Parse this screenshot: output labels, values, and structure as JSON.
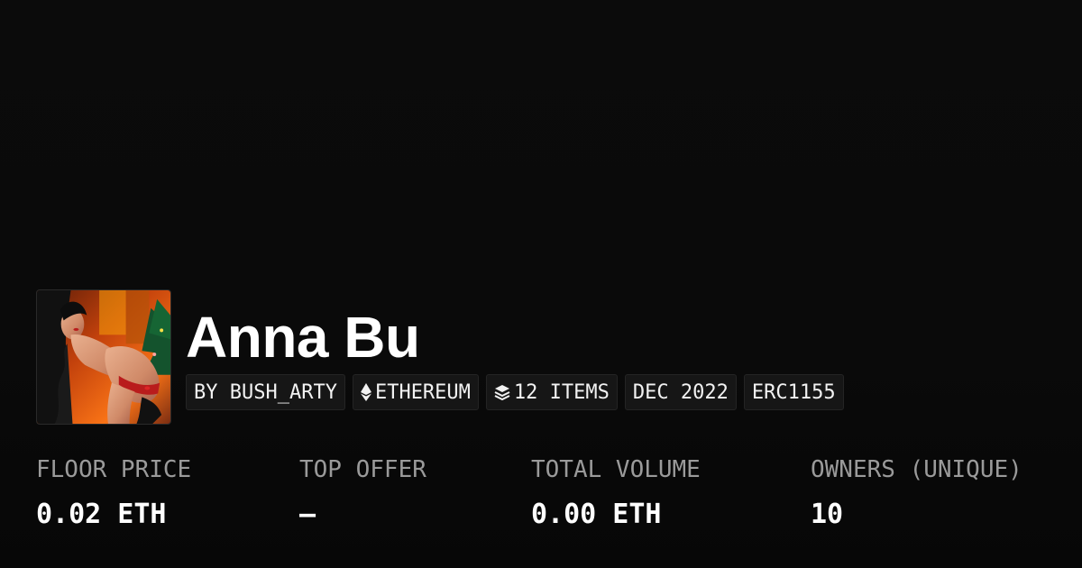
{
  "collection": {
    "name": "Anna Bu",
    "avatar_icon": "collection-artwork"
  },
  "chips": [
    {
      "label": "BY BUSH_ARTY",
      "icon": null
    },
    {
      "label": "ETHEREUM",
      "icon": "ethereum-icon"
    },
    {
      "label": "12 ITEMS",
      "icon": "layers-icon"
    },
    {
      "label": "DEC 2022",
      "icon": null
    },
    {
      "label": "ERC1155",
      "icon": null
    }
  ],
  "stats": [
    {
      "label": "FLOOR PRICE",
      "value": "0.02 ETH"
    },
    {
      "label": "TOP OFFER",
      "value": "–"
    },
    {
      "label": "TOTAL VOLUME",
      "value": "0.00 ETH"
    },
    {
      "label": "OWNERS (UNIQUE)",
      "value": "10"
    }
  ],
  "colors": {
    "background": "#0a0a0a",
    "chip_background": "#161616",
    "label_gray": "#9a9a9a",
    "text_white": "#ffffff"
  }
}
